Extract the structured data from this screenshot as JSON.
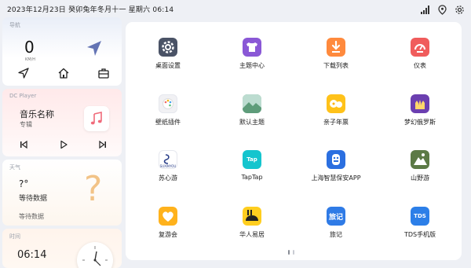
{
  "status": {
    "datetime": "2023年12月23日  癸卯兔年冬月十一  星期六  06:14",
    "icons": [
      "signal-icon",
      "location-icon",
      "settings-icon"
    ]
  },
  "nav_card": {
    "title": "导航",
    "speed": "0",
    "speed_unit": "KM/H",
    "buttons": [
      "navigate-icon",
      "home-icon",
      "briefcase-icon"
    ]
  },
  "player_card": {
    "title": "DC Player",
    "song": "音乐名称",
    "artist": "专辑",
    "controls": [
      "previous-icon",
      "play-icon",
      "next-icon"
    ]
  },
  "weather_card": {
    "title": "天气",
    "temperature": "?°",
    "status1": "等待数据",
    "status2": "等待数据",
    "placeholder_symbol": "?"
  },
  "time_card": {
    "title": "时间",
    "time": "06:14"
  },
  "apps": [
    {
      "label": "桌面设置",
      "color": "#4a5366",
      "icon": "gear-icon"
    },
    {
      "label": "主题中心",
      "color": "#8a58d6",
      "icon": "shirt-icon"
    },
    {
      "label": "下载列表",
      "color": "#ff8a3d",
      "icon": "download-icon"
    },
    {
      "label": "仪表",
      "color": "#f05c5c",
      "icon": "gauge-icon"
    },
    {
      "label": "壁纸插件",
      "color": "#f1f1f4",
      "icon": "palette-icon"
    },
    {
      "label": "默认主题",
      "color": "#6fae8c",
      "icon": "landscape-icon"
    },
    {
      "label": "亲子年票",
      "color": "#ffc21a",
      "icon": "ticket-icon"
    },
    {
      "label": "梦幻俄罗斯",
      "color": "#6b3fb0",
      "icon": "castle-icon"
    },
    {
      "label": "苏心游",
      "color": "#ffffff",
      "icon": "suxinyou-logo-icon"
    },
    {
      "label": "TapTap",
      "color": "#15c5ce",
      "icon": "taptap-icon",
      "glyph": "Tap"
    },
    {
      "label": "上海智慧保安APP",
      "color": "#2b6fe0",
      "icon": "security-guard-icon"
    },
    {
      "label": "山野游",
      "color": "#5c7a46",
      "icon": "mountain-icon"
    },
    {
      "label": "复游会",
      "color": "#ffb21c",
      "icon": "heart-icon"
    },
    {
      "label": "华人易居",
      "color": "#ffce1f",
      "icon": "rabbit-icon"
    },
    {
      "label": "旅记",
      "color": "#2f7be6",
      "icon": "travel-note-icon",
      "glyph": "旅记"
    },
    {
      "label": "TDS手机版",
      "color": "#2c7fe8",
      "icon": "tds-icon",
      "glyph": "TDS"
    }
  ],
  "pager": {
    "pages": 2,
    "active": 1
  }
}
